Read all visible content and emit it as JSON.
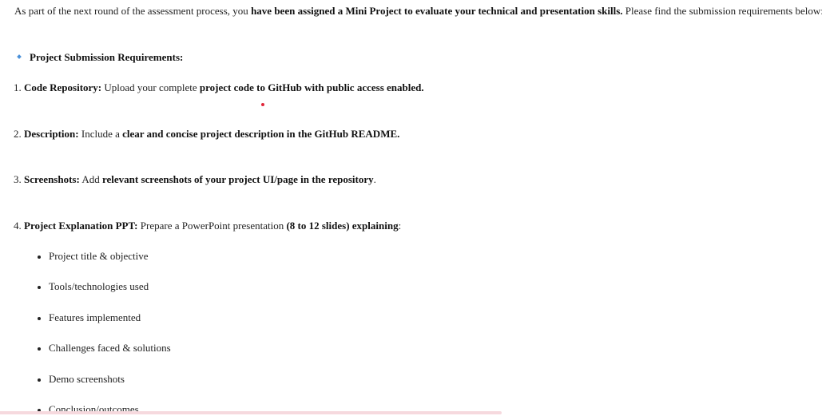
{
  "intro": {
    "text_1": "As part of the next round of the assessment process, you ",
    "bold_1": "have been assigned a Mini Project to evaluate your technical and presentation skills.",
    "text_2": " Please find the submission requirements below:"
  },
  "requirements_heading": "Project Submission Requirements:",
  "items": [
    {
      "number": "1. ",
      "title": "Code Repository:",
      "text_1": " Upload your complete ",
      "bold_1": "project code to GitHub with public access enabled.",
      "text_2": ""
    },
    {
      "number": "2. ",
      "title": "Description:",
      "text_1": " Include a ",
      "bold_1": "clear and concise project description in the GitHub README.",
      "text_2": ""
    },
    {
      "number": "3. ",
      "title": "Screenshots:",
      "text_1": " Add ",
      "bold_1": "relevant screenshots of your project UI/page in the repository",
      "text_2": "."
    },
    {
      "number": "4. ",
      "title": "Project Explanation PPT:",
      "text_1": " Prepare a PowerPoint presentation ",
      "bold_1": "(8 to 12 slides) explaining",
      "text_2": ":"
    }
  ],
  "ppt_topics": [
    "Project title & objective",
    "Tools/technologies used",
    "Features implemented",
    "Challenges faced & solutions",
    "Demo screenshots",
    "Conclusion/outcomes"
  ],
  "colors": {
    "diamond_bullet": "#4a90d9",
    "marker_dot": "#e0263a"
  }
}
